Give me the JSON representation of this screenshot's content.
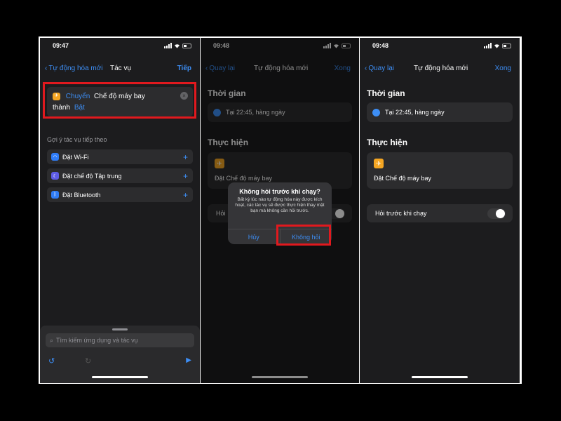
{
  "colors": {
    "accent": "#3d8ef5",
    "highlight": "#e1191e",
    "airplane": "#f5a623",
    "background": "#1c1c1e",
    "card": "#2c2c2e"
  },
  "screen1": {
    "time": "09:47",
    "nav": {
      "back_label": "Tự động hóa mới",
      "title": "Tác vụ",
      "next_label": "Tiếp"
    },
    "action": {
      "verb": "Chuyển",
      "target": "Chế độ máy bay",
      "to_label": "thành",
      "state": "Bật"
    },
    "suggestions_title": "Gợi ý tác vụ tiếp theo",
    "suggestions": [
      {
        "label": "Đặt Wi-Fi",
        "icon": "wifi-icon",
        "color": "#2f7cf6"
      },
      {
        "label": "Đặt chế độ Tập trung",
        "icon": "moon-icon",
        "color": "#5e5ce6"
      },
      {
        "label": "Đặt Bluetooth",
        "icon": "bluetooth-icon",
        "color": "#2f7cf6"
      }
    ],
    "search_placeholder": "Tìm kiếm ứng dụng và tác vụ"
  },
  "screen2": {
    "time": "09:48",
    "nav": {
      "back_label": "Quay lại",
      "title": "Tự động hóa mới",
      "done_label": "Xong"
    },
    "time_heading": "Thời gian",
    "time_value": "Tại 22:45, hàng ngày",
    "do_heading": "Thực hiện",
    "action_label": "Đặt Chế độ máy bay",
    "ask_label_partial": "Hỏi",
    "alert": {
      "title": "Không hỏi trước khi chạy?",
      "message": "Bất kỳ lúc nào tự động hóa này được kích hoạt, các tác vụ sẽ được thực hiện thay mặt bạn mà không cần hỏi trước.",
      "cancel": "Hủy",
      "confirm": "Không hỏi"
    }
  },
  "screen3": {
    "time": "09:48",
    "nav": {
      "back_label": "Quay lại",
      "title": "Tự động hóa mới",
      "done_label": "Xong"
    },
    "time_heading": "Thời gian",
    "time_value": "Tại 22:45, hàng ngày",
    "do_heading": "Thực hiện",
    "action_label": "Đặt Chế độ máy bay",
    "ask_label": "Hỏi trước khi chạy",
    "ask_toggle_on": false
  }
}
